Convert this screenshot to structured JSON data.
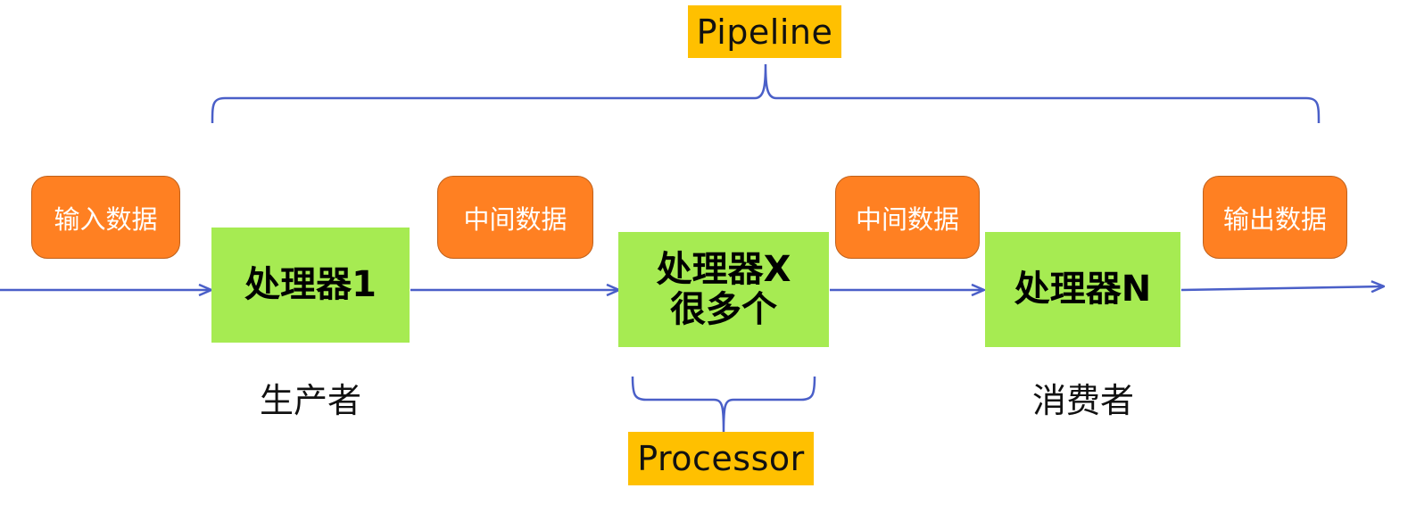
{
  "diagram": {
    "pipeline_label": "Pipeline",
    "processor_label": "Processor",
    "data_boxes": {
      "input": "输入数据",
      "intermediate_1": "中间数据",
      "intermediate_2": "中间数据",
      "output": "输出数据"
    },
    "processors": {
      "first": "处理器1",
      "middle_line1": "处理器X",
      "middle_line2": "很多个",
      "last": "处理器N"
    },
    "roles": {
      "producer": "生产者",
      "consumer": "消费者"
    },
    "colors": {
      "connector": "#4a5fc8",
      "data_box": "#ff8022",
      "processor_box": "#a6eb52",
      "label_highlight": "#ffc000"
    }
  }
}
